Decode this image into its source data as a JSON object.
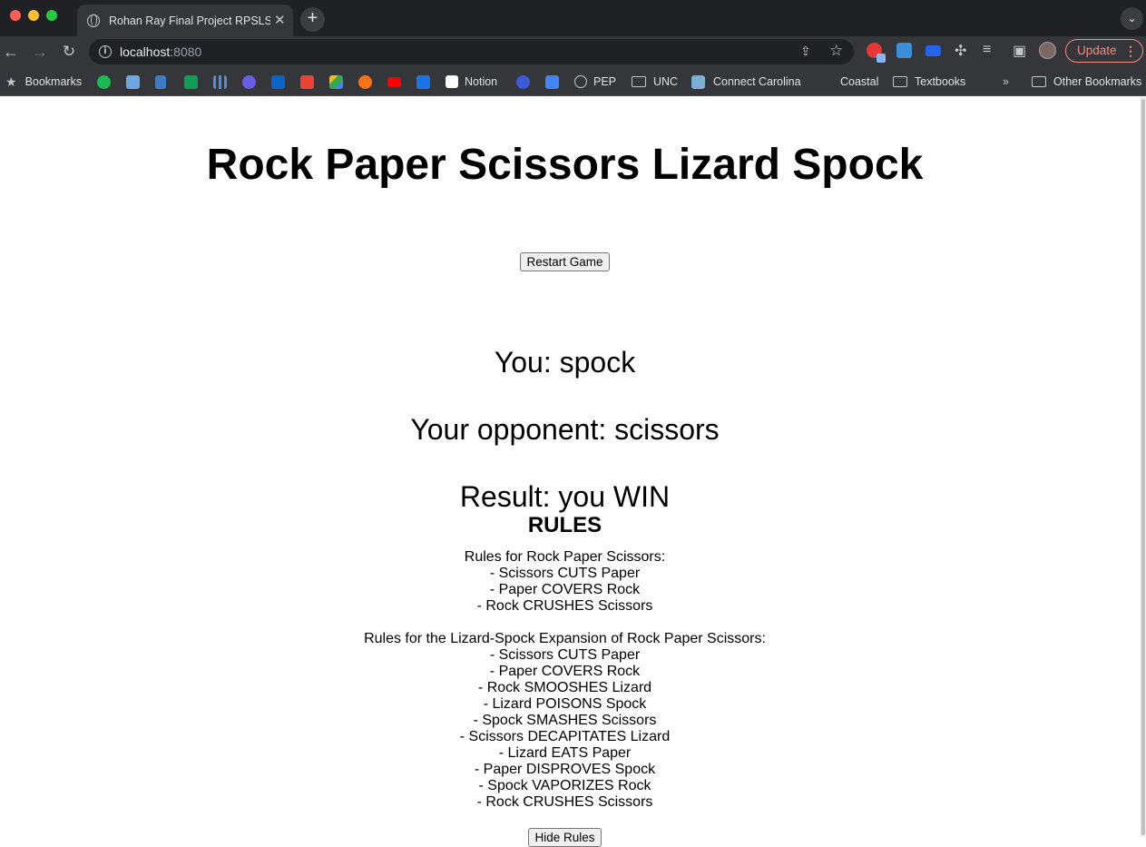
{
  "browser": {
    "tab_title": "Rohan Ray Final Project RPSLS",
    "url_host": "localhost",
    "url_port": ":8080",
    "update_label": "Update",
    "bookmarks": {
      "bookmarks_label": "Bookmarks",
      "notion": "Notion",
      "pep": "PEP",
      "unc": "UNC",
      "connect_carolina": "Connect Carolina",
      "coastal": "Coastal",
      "textbooks": "Textbooks",
      "other_bookmarks": "Other Bookmarks",
      "overflow": "»"
    }
  },
  "page": {
    "title": "Rock Paper Scissors Lizard Spock",
    "restart_button": "Restart Game",
    "you_line": "You: spock",
    "opponent_line": "Your opponent: scissors",
    "result_line": "Result: you WIN",
    "rules_heading": "RULES",
    "rps_rules": {
      "heading": "Rules for Rock Paper Scissors:",
      "items": [
        "- Scissors CUTS Paper",
        "- Paper COVERS Rock",
        "- Rock CRUSHES Scissors"
      ]
    },
    "rpsls_rules": {
      "heading": "Rules for the Lizard-Spock Expansion of Rock Paper Scissors:",
      "items": [
        "- Scissors CUTS Paper",
        "- Paper COVERS Rock",
        "- Rock SMOOSHES Lizard",
        "- Lizard POISONS Spock",
        "- Spock SMASHES Scissors",
        "- Scissors DECAPITATES Lizard",
        "- Lizard EATS Paper",
        "- Paper DISPROVES Spock",
        "- Spock VAPORIZES Rock",
        "- Rock CRUSHES Scissors"
      ]
    },
    "hide_rules_button": "Hide Rules"
  }
}
